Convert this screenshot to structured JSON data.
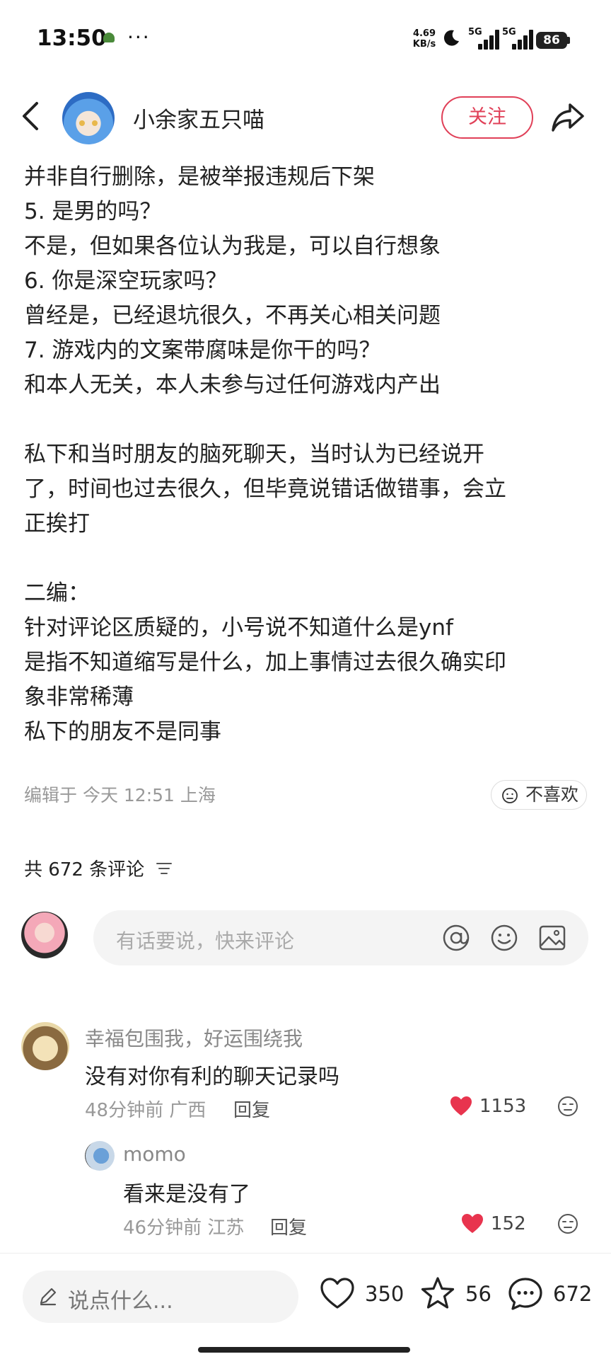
{
  "status_bar": {
    "time": "13:50",
    "dots": "···",
    "net_speed_value": "4.69",
    "net_speed_unit": "KB/s",
    "signal1_label": "5G",
    "signal2_label": "5G",
    "battery": "86",
    "icons": [
      "turtle-icon",
      "moon-icon",
      "signal-icon",
      "battery-icon"
    ]
  },
  "header": {
    "author_name": "小余家五只喵",
    "follow_label": "关注",
    "icons": [
      "back-icon",
      "share-icon"
    ]
  },
  "post": {
    "lines": [
      "并非自行删除，是被举报违规后下架",
      "5. 是男的吗？",
      "不是，但如果各位认为我是，可以自行想象",
      "6. 你是深空玩家吗？",
      "曾经是，已经退坑很久，不再关心相关问题",
      "7. 游戏内的文案带腐味是你干的吗？",
      "和本人无关，本人未参与过任何游戏内产出",
      "",
      "私下和当时朋友的脑死聊天，当时认为已经说开",
      "了，时间也过去很久，但毕竟说错话做错事，会立",
      "正挨打",
      "",
      "二编：",
      "针对评论区质疑的，小号说不知道什么是ynf",
      "是指不知道缩写是什么，加上事情过去很久确实印",
      "象非常稀薄",
      "私下的朋友不是同事"
    ],
    "meta": "编辑于 今天 12:51 上海",
    "dislike_label": "不喜欢"
  },
  "comments_section": {
    "count_label": "共 672 条评论",
    "input_placeholder": "有话要说，快来评论",
    "comments": [
      {
        "name": "幸福包围我，好运围绕我",
        "text": "没有对你有利的聊天记录吗",
        "time_loc": "48分钟前 广西",
        "reply_label": "回复",
        "likes": "1153"
      },
      {
        "name": "momo",
        "text": "看来是没有了",
        "time_loc": "46分钟前 江苏",
        "reply_label": "回复",
        "likes": "152"
      }
    ]
  },
  "bottom_bar": {
    "say_placeholder": "说点什么...",
    "likes": "350",
    "stars": "56",
    "comments": "672"
  },
  "colors": {
    "accent": "#e04058",
    "like_red": "#e8344e",
    "text_main": "#222222",
    "text_muted": "#999999"
  }
}
